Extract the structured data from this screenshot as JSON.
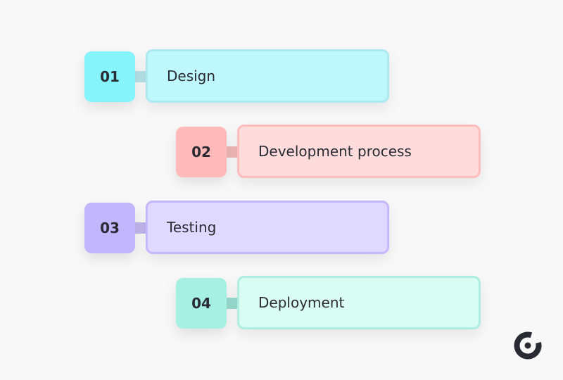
{
  "steps": [
    {
      "number": "01",
      "label": "Design",
      "badge_color": "#86f4fb",
      "card_color": "#bff8fc"
    },
    {
      "number": "02",
      "label": "Development process",
      "badge_color": "#ffb9b9",
      "card_color": "#ffdcdc"
    },
    {
      "number": "03",
      "label": "Testing",
      "badge_color": "#c2b6fd",
      "card_color": "#e0d9ff"
    },
    {
      "number": "04",
      "label": "Deployment",
      "badge_color": "#a6f0e2",
      "card_color": "#dafdf3"
    }
  ],
  "logo": {
    "icon": "brand-logo-icon",
    "color": "#2a2a33"
  }
}
